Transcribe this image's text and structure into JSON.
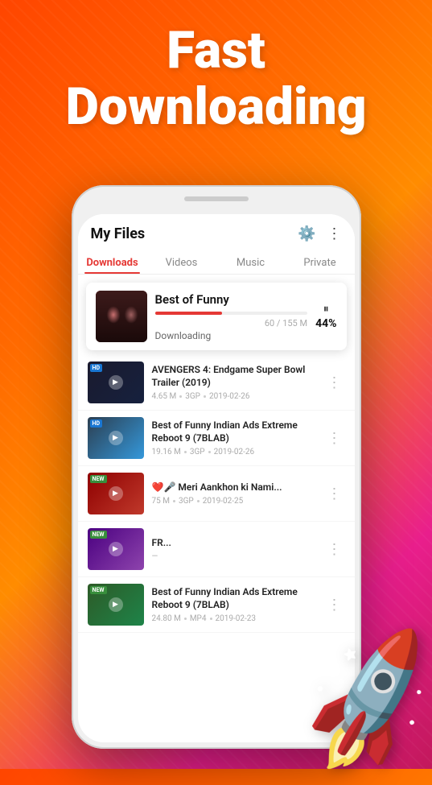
{
  "header": {
    "line1": "Fast",
    "line2": "Downloading"
  },
  "app": {
    "title": "My Files",
    "tabs": [
      "Downloads",
      "Videos",
      "Music",
      "Private"
    ],
    "active_tab": 0
  },
  "active_download": {
    "filename": "Best of Funny",
    "status": "Downloading",
    "progress": 44,
    "progress_label": "44%",
    "meta": "60 / 155 M",
    "pause_icon": "⏸"
  },
  "files": [
    {
      "name": "AVENGERS 4: Endgame Super Bowl Trailer (2019)",
      "size": "4.65 M",
      "format": "3GP",
      "date": "2019-02-26",
      "thumb_class": "file-thumb-1",
      "label": "HD",
      "label_class": "thumb-label-hd"
    },
    {
      "name": "Best of Funny Indian Ads Extreme Reboot 9 (7BLAB)",
      "size": "19.16 M",
      "format": "3GP",
      "date": "2019-02-26",
      "thumb_class": "file-thumb-2",
      "label": "HD",
      "label_class": "thumb-label-hd"
    },
    {
      "name": "❤️🎤 Meri Aankhon ki Nami...",
      "size": "75 M",
      "format": "3GP",
      "date": "2019-02-25",
      "thumb_class": "file-thumb-3",
      "label": "NEW",
      "label_class": "thumb-label-new"
    },
    {
      "name": "FR...",
      "size": "—",
      "format": "—",
      "date": "—",
      "thumb_class": "file-thumb-4",
      "label": "NEW",
      "label_class": "thumb-label-new"
    },
    {
      "name": "Best of Funny Indian Ads Extreme Reboot 9 (7BLAB)",
      "size": "24.80 M",
      "format": "MP4",
      "date": "2019-02-23",
      "thumb_class": "file-thumb-5",
      "label": "NEW",
      "label_class": "thumb-label-new"
    }
  ]
}
